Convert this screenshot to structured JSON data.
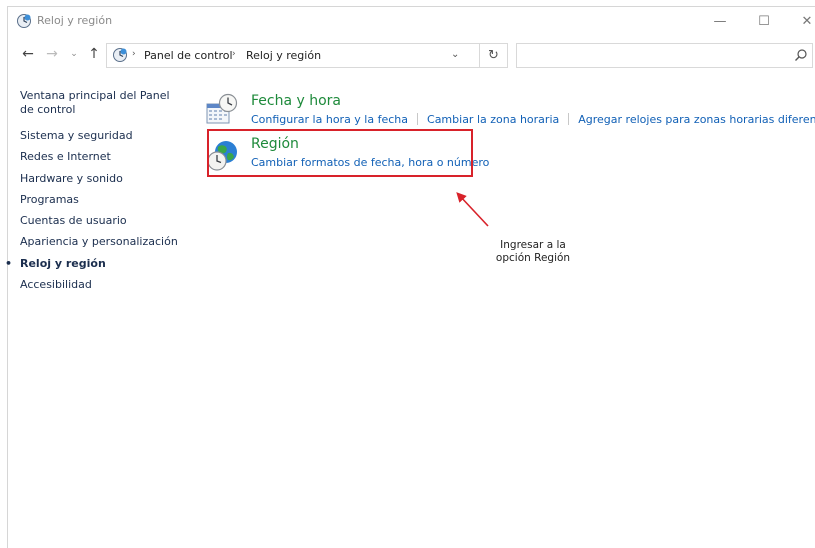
{
  "window": {
    "title": "Reloj y región",
    "controls": {
      "minimize": "—",
      "maximize": "☐",
      "close": "✕"
    }
  },
  "navigation": {
    "back": "←",
    "forward": "→",
    "recent": "⌄",
    "up": "↑",
    "breadcrumbs": [
      "Panel de control",
      "Reloj y región"
    ],
    "separator": "›",
    "dropdown": "⌄",
    "refresh": "↻"
  },
  "search": {
    "value": "",
    "placeholder": ""
  },
  "sidebar": {
    "home": "Ventana principal del Panel de control",
    "items": [
      {
        "label": "Sistema y seguridad"
      },
      {
        "label": "Redes e Internet"
      },
      {
        "label": "Hardware y sonido"
      },
      {
        "label": "Programas"
      },
      {
        "label": "Cuentas de usuario"
      },
      {
        "label": "Apariencia y personalización"
      },
      {
        "label": "Reloj y región",
        "active": true
      },
      {
        "label": "Accesibilidad"
      }
    ],
    "bullet": "•"
  },
  "categories": {
    "datetime": {
      "title": "Fecha y hora",
      "links": [
        "Configurar la hora y la fecha",
        "Cambiar la zona horaria",
        "Agregar relojes para zonas horarias diferentes"
      ]
    },
    "region": {
      "title": "Región",
      "links": [
        "Cambiar formatos de fecha, hora o número"
      ]
    }
  },
  "annotation": {
    "line1": "Ingresar a la",
    "line2": "opción Región"
  },
  "colors": {
    "highlight": "#d8222a",
    "link": "#1160b6",
    "categoryTitle": "#1e8a3b"
  }
}
